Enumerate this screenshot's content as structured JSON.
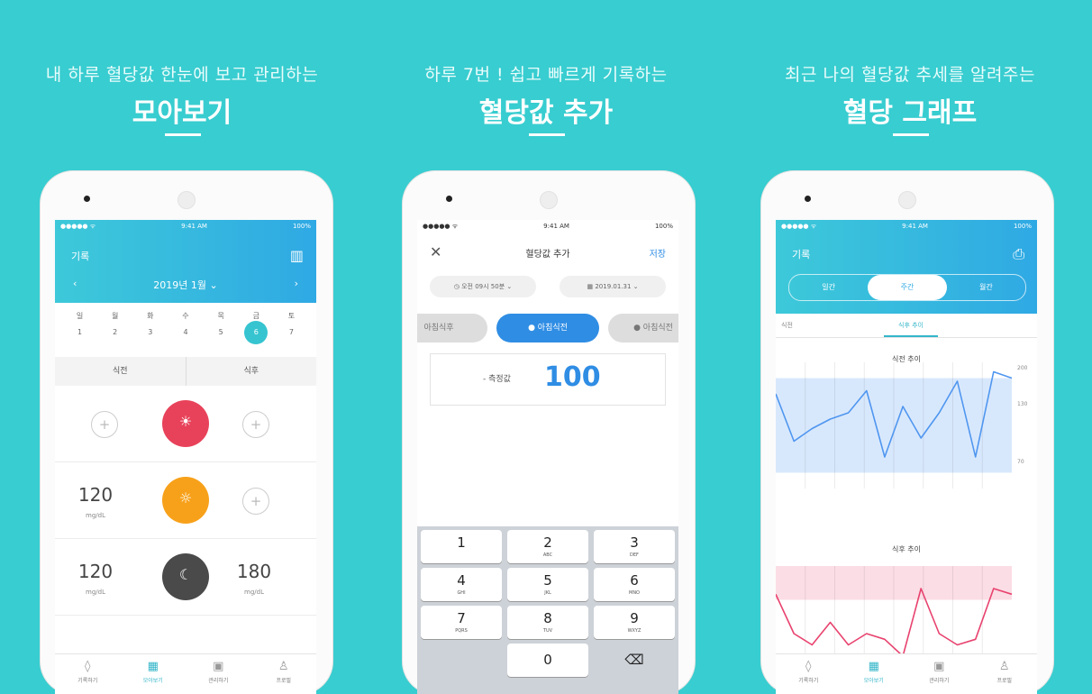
{
  "panels": [
    {
      "subtitle": "내 하루 혈당값 한눈에 보고 관리하는",
      "title": "모아보기",
      "screen": {
        "status_time": "9:41 AM",
        "status_battery": "100%",
        "header_label": "기록",
        "month": "2019년 1월",
        "weekdays": [
          "일",
          "월",
          "화",
          "수",
          "목",
          "금",
          "토"
        ],
        "dates": [
          "1",
          "2",
          "3",
          "4",
          "5",
          "6",
          "7"
        ],
        "segment": [
          "식전",
          "식후"
        ],
        "rows": [
          {
            "left": "",
            "right": "",
            "meal_color": "#e8425a"
          },
          {
            "left": "120",
            "right": "",
            "meal_color": "#f7a11a"
          },
          {
            "left": "120",
            "right": "180",
            "meal_color": "#4a4a4a"
          }
        ],
        "unit": "mg/dL",
        "tabs": [
          "기록하기",
          "모아보기",
          "관리하기",
          "프로필"
        ]
      }
    },
    {
      "subtitle": "하루 7번 ! 쉽고 빠르게 기록하는",
      "title": "혈당값 추가",
      "screen": {
        "status_time": "9:41 AM",
        "status_battery": "100%",
        "nav_title": "혈당값 추가",
        "save": "저장",
        "pill_time": "오전 09시 50분",
        "pill_date": "2019.01.31",
        "chips": [
          "아침식후",
          "아침식전",
          "아침식전"
        ],
        "entry_label": "- 측정값",
        "entry_value": "100",
        "keys": [
          {
            "n": "1",
            "s": ""
          },
          {
            "n": "2",
            "s": "ABC"
          },
          {
            "n": "3",
            "s": "DEF"
          },
          {
            "n": "4",
            "s": "GHI"
          },
          {
            "n": "5",
            "s": "JKL"
          },
          {
            "n": "6",
            "s": "MNO"
          },
          {
            "n": "7",
            "s": "PQRS"
          },
          {
            "n": "8",
            "s": "TUV"
          },
          {
            "n": "9",
            "s": "WXYZ"
          },
          {
            "n": "",
            "s": ""
          },
          {
            "n": "0",
            "s": ""
          },
          {
            "n": "⌫",
            "s": ""
          }
        ]
      }
    },
    {
      "subtitle": "최근 나의 혈당값 추세를 알려주는",
      "title": "혈당 그래프",
      "screen": {
        "status_time": "9:41 AM",
        "status_battery": "100%",
        "header_label": "기록",
        "segment": [
          "일간",
          "주간",
          "월간"
        ],
        "tabs": [
          "식전",
          "식후 추이"
        ],
        "chart1_title": "식전 추이",
        "chart2_title": "식후 추이",
        "tabbar": [
          "기록하기",
          "모아보기",
          "관리하기",
          "프로필"
        ]
      }
    }
  ],
  "chart_data": [
    {
      "type": "line",
      "title": "식전 추이",
      "y": [
        120,
        90,
        98,
        104,
        108,
        122,
        80,
        112,
        92,
        108,
        128,
        80,
        134,
        130
      ],
      "ylim": [
        60,
        140
      ],
      "yticks": [
        "200",
        "130",
        "70"
      ],
      "band": [
        70,
        130
      ],
      "color": "#4f96f0"
    },
    {
      "type": "line",
      "title": "식후 추이",
      "y": [
        150,
        80,
        60,
        100,
        60,
        80,
        70,
        40,
        160,
        80,
        60,
        70,
        160,
        150
      ],
      "ylim": [
        40,
        200
      ],
      "band": [
        140,
        200
      ],
      "color": "#e8426e"
    }
  ]
}
